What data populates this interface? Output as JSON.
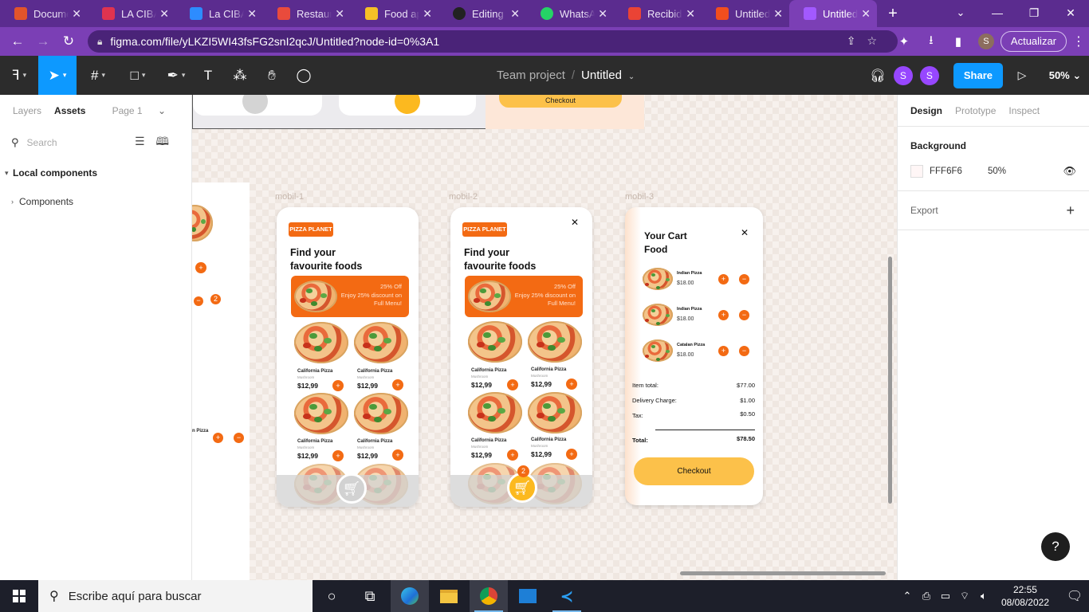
{
  "browser": {
    "tabs": [
      {
        "title": "Docume",
        "color": "#e2542b"
      },
      {
        "title": "LA CIBA",
        "color": "#e0334f"
      },
      {
        "title": "La CIBA",
        "color": "#2d8cff"
      },
      {
        "title": "Restaura",
        "color": "#e94b3c"
      },
      {
        "title": "Food ap",
        "color": "#f6c026"
      },
      {
        "title": "Editing r",
        "color": "#222222"
      },
      {
        "title": "WhatsAp",
        "color": "#25d366"
      },
      {
        "title": "Recibido",
        "color": "#ea4335"
      },
      {
        "title": "Untitled",
        "color": "#f24e1e"
      },
      {
        "title": "Untitled",
        "color": "#a259ff"
      }
    ],
    "new_tab": "+",
    "url": "figma.com/file/yLKZI5WI43fsFG2snI2qcJ/Untitled?node-id=0%3A1",
    "profile_initial": "S",
    "update_label": "Actualizar"
  },
  "figma": {
    "project": "Team project",
    "file": "Untitled",
    "users": [
      "S",
      "S"
    ],
    "share_label": "Share",
    "zoom": "50%"
  },
  "left_panel": {
    "tabs": [
      "Layers",
      "Assets"
    ],
    "page": "Page 1",
    "search_placeholder": "Search",
    "local_components": "Local components",
    "components": "Components"
  },
  "canvas": {
    "top_checkout": "Checkout",
    "left_pizza_label": "n Pizza",
    "left_badge": "2",
    "frames": [
      {
        "label": "mobil-1",
        "logo": "PIZZA PLANET",
        "headline": "Find your favourite foods",
        "promo_line1": "25% Off",
        "promo_line2": "Enjoy 25% discount on",
        "promo_line3": "Full Menu!",
        "items": [
          {
            "name": "California Pizza",
            "sub": "Mushroom",
            "price": "$12,99"
          },
          {
            "name": "California Pizza",
            "sub": "Mushroom",
            "price": "$12,99"
          },
          {
            "name": "California Pizza",
            "sub": "Mushroom",
            "price": "$12,99"
          },
          {
            "name": "California Pizza",
            "sub": "Mushroom",
            "price": "$12,99"
          }
        ]
      },
      {
        "label": "mobil-2",
        "logo": "PIZZA PLANET",
        "headline": "Find your favourite foods",
        "promo_line1": "25% Off",
        "promo_line2": "Enjoy 25% discount on",
        "promo_line3": "Full Menu!",
        "badge": "2",
        "items": [
          {
            "name": "California Pizza",
            "sub": "Mushroom",
            "price": "$12,99"
          },
          {
            "name": "California Pizza",
            "sub": "Mushroom",
            "price": "$12,99"
          },
          {
            "name": "California Pizza",
            "sub": "Mushroom",
            "price": "$12,99"
          },
          {
            "name": "California Pizza",
            "sub": "Mushroom",
            "price": "$12,99"
          }
        ]
      }
    ],
    "cart": {
      "label": "mobil-3",
      "title_line1": "Your Cart",
      "title_line2": "Food",
      "items": [
        {
          "name": "Indian Pizza",
          "price": "$18.00"
        },
        {
          "name": "Indian Pizza",
          "price": "$18.00"
        },
        {
          "name": "Catalan Pizza",
          "price": "$18.00"
        }
      ],
      "item_total_label": "Item total:",
      "item_total": "$77.00",
      "delivery_label": "Delivery Charge:",
      "delivery": "$1.00",
      "tax_label": "Tax:",
      "tax": "$0.50",
      "total_label": "Total:",
      "total": "$78.50",
      "checkout": "Checkout"
    }
  },
  "right_panel": {
    "tabs": [
      "Design",
      "Prototype",
      "Inspect"
    ],
    "background_title": "Background",
    "bg_hex": "FFF6F6",
    "bg_opacity": "50%",
    "export_title": "Export"
  },
  "help": "?",
  "taskbar": {
    "search_placeholder": "Escribe aquí para buscar",
    "time": "22:55",
    "date": "08/08/2022"
  },
  "colors": {
    "accent_orange": "#f36a13",
    "checkout_yellow": "#fcc14a",
    "figma_blue": "#0d99ff",
    "browser_purple": "#7b3fb5"
  }
}
